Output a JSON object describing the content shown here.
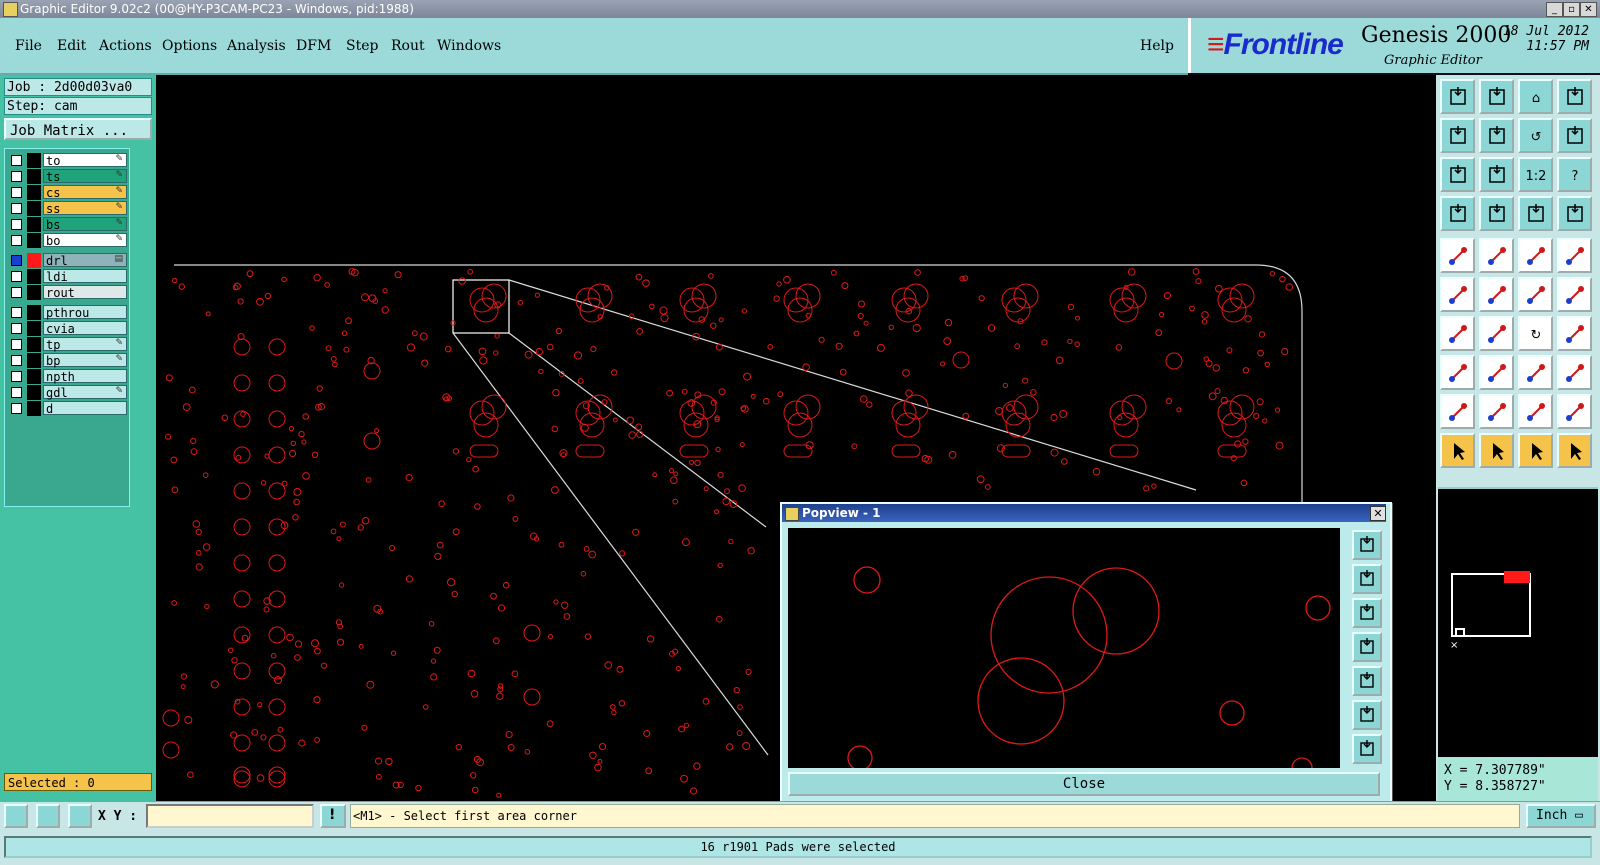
{
  "window": {
    "title": "Graphic Editor 9.02c2 (00@HY-P3CAM-PC23 - Windows, pid:1988)",
    "minimize": "_",
    "maximize": "▫",
    "close": "✕"
  },
  "menu": {
    "items": [
      "File",
      "Edit",
      "Actions",
      "Options",
      "Analysis",
      "DFM",
      "Step",
      "Rout",
      "Windows"
    ],
    "help": "Help"
  },
  "brand": {
    "logo": "Frontline",
    "product": "Genesis 2000",
    "subtitle": "Graphic Editor",
    "date": "18 Jul 2012",
    "time": "11:57 PM"
  },
  "job": {
    "job_line": "Job : 2d00d03va0",
    "step_line": "Step: cam",
    "matrix_button": "Job Matrix ..."
  },
  "layers": [
    {
      "name": "to",
      "color": "#ffffff",
      "checked": false,
      "mark": "✎"
    },
    {
      "name": "ts",
      "color": "#1fa37a",
      "checked": false,
      "mark": "✎"
    },
    {
      "name": "cs",
      "color": "#f5c24a",
      "checked": false,
      "mark": "✎"
    },
    {
      "name": "ss",
      "color": "#f5c24a",
      "checked": false,
      "mark": "✎"
    },
    {
      "name": "bs",
      "color": "#1fa37a",
      "checked": false,
      "mark": "✎"
    },
    {
      "name": "bo",
      "color": "#ffffff",
      "checked": false,
      "mark": "✎"
    },
    {
      "name": "drl",
      "color": "#8fb3b8",
      "checked": true,
      "mark": "▤",
      "active": true
    },
    {
      "name": "ldi",
      "color": "#bde8e8",
      "checked": false,
      "mark": ""
    },
    {
      "name": "rout",
      "color": "#dfe8e8",
      "checked": false,
      "mark": ""
    },
    {
      "name": "pthrou",
      "color": "#bde8e8",
      "checked": false,
      "mark": ""
    },
    {
      "name": "cvia",
      "color": "#bde8e8",
      "checked": false,
      "mark": ""
    },
    {
      "name": "tp",
      "color": "#bde8e8",
      "checked": false,
      "mark": "✎"
    },
    {
      "name": "bp",
      "color": "#bde8e8",
      "checked": false,
      "mark": "✎"
    },
    {
      "name": "npth",
      "color": "#bde8e8",
      "checked": false,
      "mark": ""
    },
    {
      "name": "gdl",
      "color": "#bde8e8",
      "checked": false,
      "mark": "✎"
    },
    {
      "name": "d",
      "color": "#bde8e8",
      "checked": false,
      "mark": ""
    }
  ],
  "selection": {
    "label": "Selected : 0"
  },
  "popview": {
    "title": "Popview - 1",
    "close_label": "Close",
    "tools": [
      "zoom-window-icon",
      "arrow-up-icon",
      "arrow-down-icon",
      "arrow-left-icon",
      "arrow-right-icon",
      "zoom-fit-icon",
      "zoom-home-icon"
    ]
  },
  "toolbar": {
    "rows": [
      [
        "pan-up-icon",
        "pan-down-icon",
        "home-icon",
        "zoom-window-icon"
      ],
      [
        "pan-left-icon",
        "pan-right-icon",
        "undo-zoom-icon",
        "redraw-icon"
      ],
      [
        "fit-icon",
        "zoom-center-icon",
        "scale-1-2-icon",
        "help-icon"
      ],
      [
        "measure-icon",
        "snap-icon",
        "net-left-icon",
        "net-right-icon"
      ],
      [
        "add-pad-icon",
        "add-line-icon",
        "ruler-icon",
        "select-pad-icon"
      ],
      [
        "connect-icon",
        "delete-icon",
        "move-icon",
        "copy-icon"
      ],
      [
        "edit-angle-icon",
        "slash-icon",
        "rotate-icon",
        "mirror-icon"
      ],
      [
        "add-shape-icon",
        "resize-icon",
        "stretch-icon",
        "attribute-icon"
      ],
      [
        "triangle-icon",
        "triangle-up-icon",
        "arc-icon",
        "arc-edit-icon"
      ],
      [
        "pointer-icon",
        "pointer-box-icon",
        "pointer-select-icon",
        "pointer-net-icon"
      ]
    ],
    "coord_x": "X =  7.307789\"",
    "coord_y": "Y =  8.358727\""
  },
  "command": {
    "xy_label": "X Y :",
    "xy_value": "",
    "prompt": "<M1> - Select first area corner",
    "units": "Inch ▭"
  },
  "status": {
    "message": "16 r1901 Pads were selected"
  }
}
